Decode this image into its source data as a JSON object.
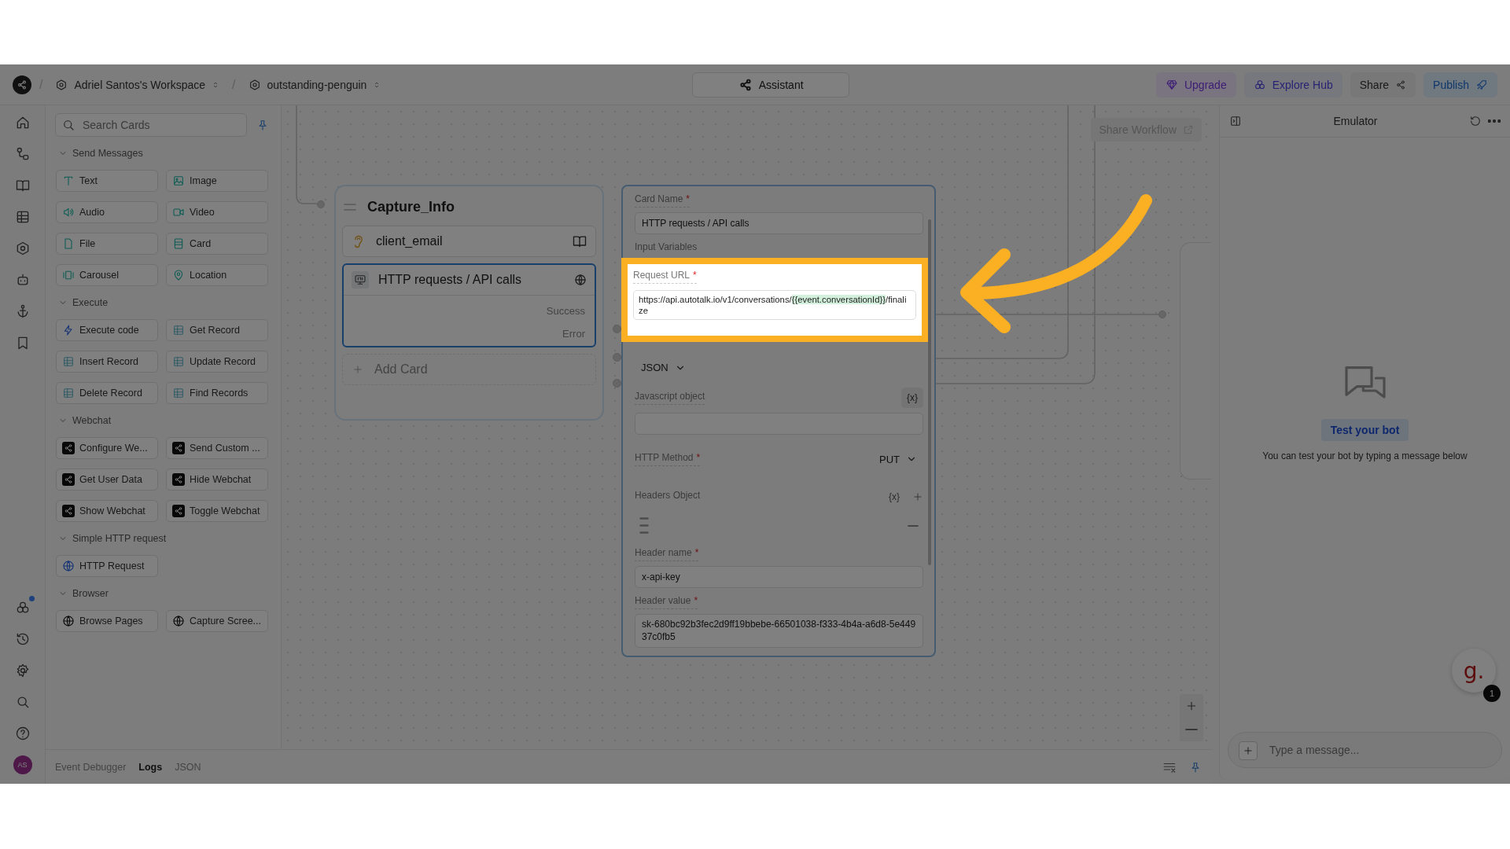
{
  "topbar": {
    "workspace": "Adriel Santos's Workspace",
    "separator": "/",
    "project": "outstanding-penguin",
    "assistant": "Assistant",
    "actions": [
      {
        "label": "Upgrade",
        "kind": "upgrade"
      },
      {
        "label": "Explore Hub",
        "kind": "hub"
      },
      {
        "label": "Share",
        "kind": "share"
      },
      {
        "label": "Publish",
        "kind": "publish"
      }
    ]
  },
  "rail": {
    "avatar": "AS"
  },
  "sidebar": {
    "search_placeholder": "Search Cards",
    "sections": [
      {
        "title": "Send Messages",
        "expanded": true,
        "items": [
          {
            "label": "Text",
            "kind": "text"
          },
          {
            "label": "Image",
            "kind": "image"
          },
          {
            "label": "Audio",
            "kind": "audio"
          },
          {
            "label": "Video",
            "kind": "video"
          },
          {
            "label": "File",
            "kind": "file"
          },
          {
            "label": "Card",
            "kind": "card"
          },
          {
            "label": "Carousel",
            "kind": "carousel"
          },
          {
            "label": "Location",
            "kind": "location"
          }
        ]
      },
      {
        "title": "Execute",
        "expanded": true,
        "items": [
          {
            "label": "Execute code",
            "kind": "code"
          },
          {
            "label": "Get Record",
            "kind": "record"
          },
          {
            "label": "Insert Record",
            "kind": "record"
          },
          {
            "label": "Update Record",
            "kind": "record"
          },
          {
            "label": "Delete Record",
            "kind": "record"
          },
          {
            "label": "Find Records",
            "kind": "record"
          }
        ]
      },
      {
        "title": "Webchat",
        "expanded": true,
        "items": [
          {
            "label": "Configure We...",
            "kind": "webchat"
          },
          {
            "label": "Send Custom ...",
            "kind": "webchat"
          },
          {
            "label": "Get User Data",
            "kind": "webchat"
          },
          {
            "label": "Hide Webchat",
            "kind": "webchat"
          },
          {
            "label": "Show Webchat",
            "kind": "webchat"
          },
          {
            "label": "Toggle Webchat",
            "kind": "webchat"
          }
        ]
      },
      {
        "title": "Simple HTTP request",
        "expanded": true,
        "items": [
          {
            "label": "HTTP Request",
            "kind": "http"
          }
        ]
      },
      {
        "title": "Browser",
        "expanded": true,
        "items": [
          {
            "label": "Browse Pages",
            "kind": "browser"
          },
          {
            "label": "Capture Scree...",
            "kind": "browser"
          }
        ]
      }
    ]
  },
  "debugger": {
    "tabs": [
      {
        "label": "Event Debugger",
        "selected": false
      },
      {
        "label": "Logs",
        "selected": true
      },
      {
        "label": "JSON",
        "selected": false
      }
    ]
  },
  "canvas": {
    "share_workflow": "Share Workflow",
    "node": {
      "title": "Capture_Info",
      "cards": [
        {
          "kind": "input",
          "label": "client_email",
          "selected": false
        },
        {
          "kind": "http",
          "label": "HTTP requests / API calls",
          "selected": true,
          "outputs": [
            "Success",
            "Error"
          ]
        }
      ],
      "add_card": "Add Card"
    }
  },
  "config": {
    "card_name": {
      "label": "Card Name",
      "mark": "*",
      "value": "HTTP requests / API calls"
    },
    "input_variables": "Input Variables",
    "request_url": {
      "label": "Request URL",
      "mark": "*",
      "before": "https://api.autotalk.io/v1/conversations/",
      "variable": "{{event.conversationId}}",
      "after": "/finalize"
    },
    "body_type": "JSON",
    "javascript_object": {
      "label": "Javascript object",
      "button": "{x}"
    },
    "http_method": {
      "label": "HTTP Method",
      "mark": "*",
      "value": "PUT"
    },
    "headers": {
      "label": "Headers Object",
      "button": "{x}"
    },
    "header_name": {
      "label": "Header name",
      "mark": "*",
      "value": "x-api-key"
    },
    "header_value": {
      "label": "Header value",
      "mark": "*",
      "value": "sk-680bc92b3fec2d9ff19bbebe-66501038-f333-4b4a-a6d8-5e44937c0fb5"
    }
  },
  "emulator": {
    "title": "Emulator",
    "cta": "Test your bot",
    "hint": "You can test your bot by typing a message below",
    "placeholder": "Type a message...",
    "launcher": "g.",
    "badge": "1"
  }
}
